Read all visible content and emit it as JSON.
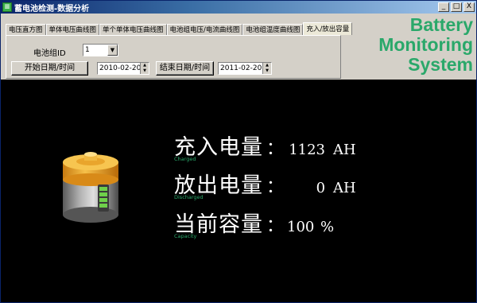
{
  "window": {
    "title": "蓄电池检测-数据分析",
    "buttons": [
      "_",
      "□",
      "X"
    ]
  },
  "tabs": [
    {
      "label": "电压直方图",
      "active": false
    },
    {
      "label": "单体电压曲线图",
      "active": false
    },
    {
      "label": "单个单体电压曲线图",
      "active": false
    },
    {
      "label": "电池组电压/电流曲线图",
      "active": false
    },
    {
      "label": "电池组温度曲线图",
      "active": false
    },
    {
      "label": "充入/放出容量",
      "active": true
    }
  ],
  "controls": {
    "battery_group_label": "电池组ID",
    "battery_group_value": "1",
    "start_button": "开始日期/时间",
    "start_date": "2010-02-20",
    "end_button": "结束日期/时间",
    "end_date": "2011-02-20"
  },
  "brand": {
    "line1": "Battery",
    "line2": "Monitoring",
    "line3": "System"
  },
  "stats": [
    {
      "label": "充入电量",
      "colon": "：",
      "value": "1123",
      "unit": "AH",
      "sub": "Charged"
    },
    {
      "label": "放出电量",
      "colon": "：",
      "value": "0",
      "unit": "AH",
      "sub": "Discharged"
    },
    {
      "label": "当前容量",
      "colon": "：",
      "value": "100",
      "unit": "%",
      "sub": "Capacity"
    }
  ],
  "colors": {
    "brand_green": "#2aa86a",
    "battery_orange": "#f0a020",
    "battery_gray": "#8a8a8a"
  }
}
